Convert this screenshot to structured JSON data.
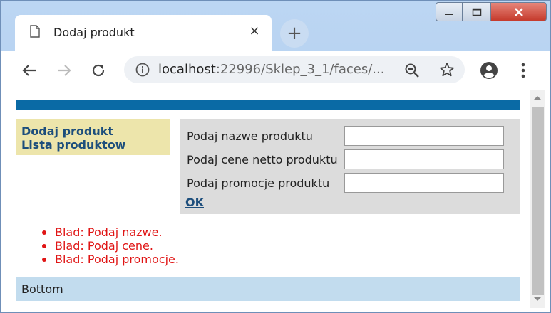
{
  "browser": {
    "tab_title": "Dodaj produkt",
    "tab_close": "×",
    "new_tab": "+",
    "url_host": "localhost",
    "url_path": ":22996/Sklep_3_1/faces/..."
  },
  "page": {
    "menu": [
      "Dodaj produkt",
      "Lista produktow"
    ],
    "form": {
      "name_label": "Podaj nazwe produktu",
      "price_label": "Podaj cene netto produktu",
      "promo_label": "Podaj promocje produktu",
      "submit": "OK"
    },
    "errors": [
      "Blad: Podaj nazwe.",
      "Blad: Podaj cene.",
      "Blad: Podaj promocje."
    ],
    "footer": "Bottom"
  },
  "colors": {
    "header_bar": "#0a6aa5",
    "menu_bg": "#ede5ab",
    "form_bg": "#dcdcdc",
    "link": "#1d4e7c",
    "error": "#e01515",
    "footer_bg": "#c2dcee"
  },
  "icons": [
    "document-icon",
    "close-icon",
    "plus-icon",
    "minimize-icon",
    "maximize-icon",
    "window-close-icon",
    "back-arrow-icon",
    "forward-arrow-icon",
    "reload-icon",
    "info-icon",
    "zoom-out-icon",
    "star-icon",
    "account-icon",
    "more-menu-icon"
  ]
}
